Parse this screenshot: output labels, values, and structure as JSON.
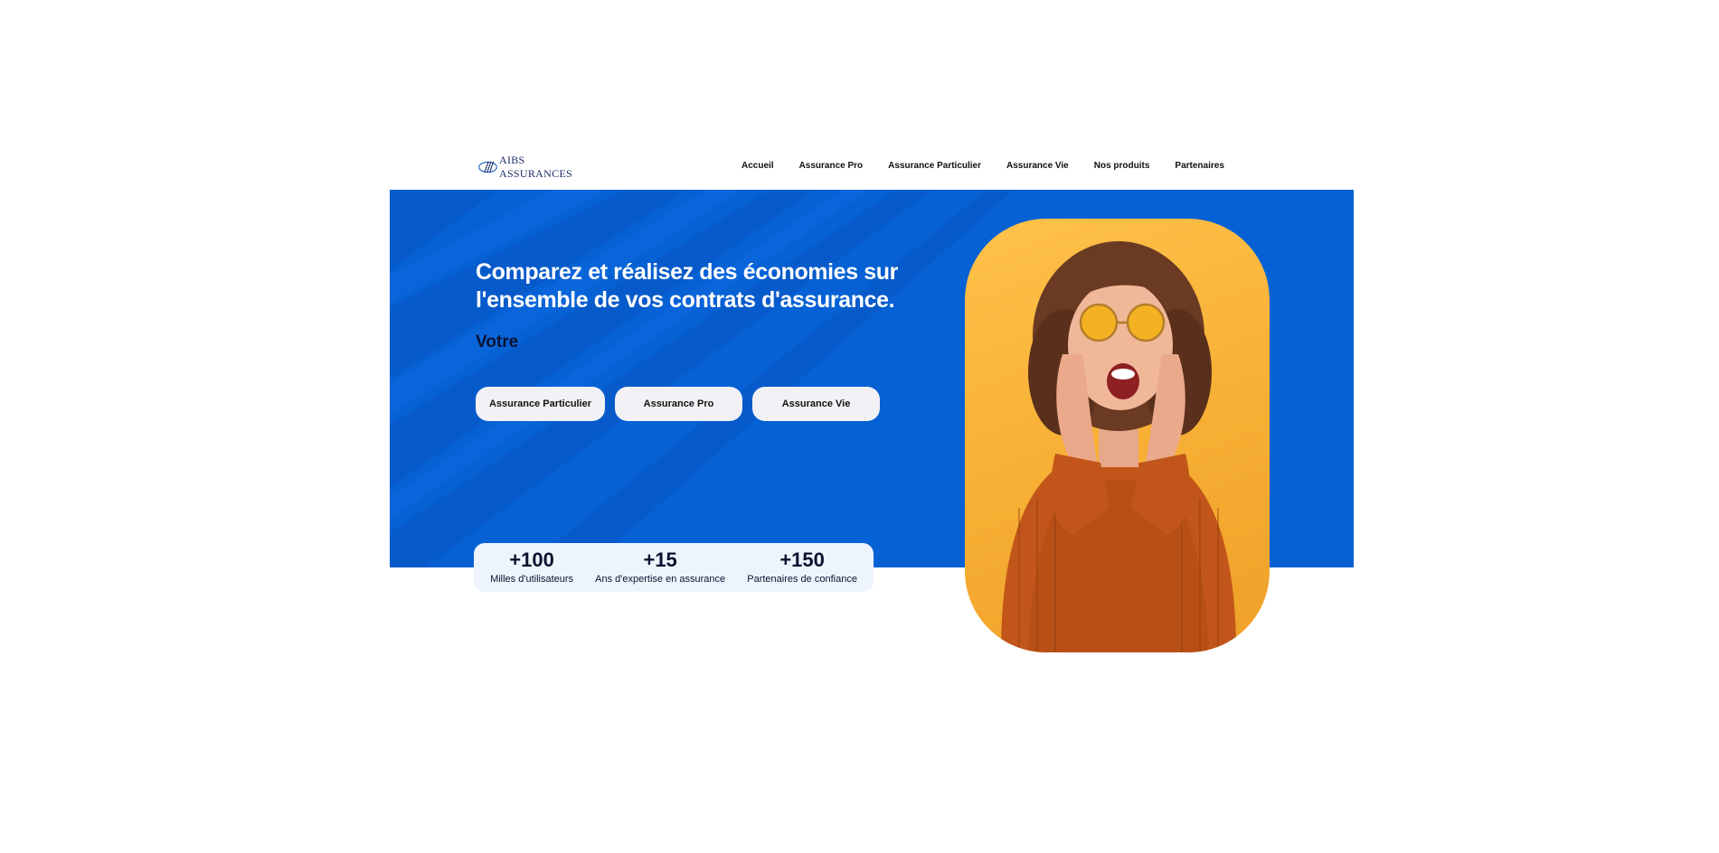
{
  "header": {
    "logo_alt": "AIBS Assurances",
    "logo_text": "AIBS ASSURANCES",
    "nav": [
      {
        "label": "Accueil"
      },
      {
        "label": "Assurance Pro"
      },
      {
        "label": "Assurance Particulier"
      },
      {
        "label": "Assurance Vie"
      },
      {
        "label": "Nos produits"
      },
      {
        "label": "Partenaires"
      }
    ]
  },
  "hero": {
    "headline": "Comparez et réalisez des économies sur l'ensemble de vos contrats d'assurance.",
    "subhead": "Votre",
    "buttons": [
      {
        "label": "Assurance Particulier"
      },
      {
        "label": "Assurance Pro"
      },
      {
        "label": "Assurance Vie"
      }
    ],
    "stats": [
      {
        "value": "+100",
        "label": "Milles d'utilisateurs"
      },
      {
        "value": "+15",
        "label": "Ans d'expertise en assurance"
      },
      {
        "value": "+150",
        "label": "Partenaires de confiance"
      }
    ],
    "photo_alt": "surprised-woman-photo"
  },
  "colors": {
    "hero_blue": "#0561d4",
    "photo_bg": "#f7b035",
    "headline": "#ffffff",
    "dark_text": "#0b1230",
    "button_bg": "#f2f2f6",
    "stats_bg": "#eef4fc"
  }
}
